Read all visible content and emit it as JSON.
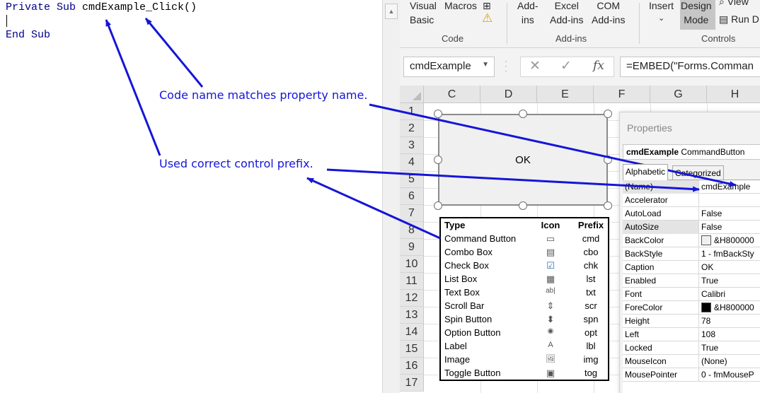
{
  "code": {
    "line1_kw": "Private Sub",
    "line1_name": " cmdExample_Click()",
    "line2": "End Sub"
  },
  "ribbon": {
    "visual_basic": "Visual\nBasic",
    "macros": "Macros",
    "addins": "Add-\nins",
    "excel_addins": "Excel\nAdd-ins",
    "com_addins": "COM\nAdd-ins",
    "insert": "Insert",
    "design_mode": "Design\nMode",
    "view_partial": "View",
    "run_partial": "Run D",
    "group_code": "Code",
    "group_addins": "Add-ins",
    "group_controls": "Controls"
  },
  "formula_bar": {
    "name_box": "cmdExample",
    "formula": "=EMBED(\"Forms.Comman"
  },
  "grid": {
    "columns": [
      "C",
      "D",
      "E",
      "F",
      "G",
      "H"
    ],
    "rows": [
      "1",
      "2",
      "3",
      "4",
      "5",
      "6",
      "7",
      "8",
      "9",
      "10",
      "11",
      "12",
      "13",
      "14",
      "15",
      "16",
      "17"
    ]
  },
  "ok_button": {
    "caption": "OK"
  },
  "prefix_table": {
    "headers": {
      "type": "Type",
      "icon": "Icon",
      "prefix": "Prefix"
    },
    "rows": [
      {
        "type": "Command Button",
        "icon": "▭",
        "prefix": "cmd"
      },
      {
        "type": "Combo Box",
        "icon": "▤",
        "prefix": "cbo"
      },
      {
        "type": "Check Box",
        "icon": "☑",
        "prefix": "chk"
      },
      {
        "type": "List Box",
        "icon": "▦",
        "prefix": "lst"
      },
      {
        "type": "Text Box",
        "icon": "ab|",
        "prefix": "txt"
      },
      {
        "type": "Scroll Bar",
        "icon": "⇕",
        "prefix": "scr"
      },
      {
        "type": "Spin Button",
        "icon": "⬍",
        "prefix": "spn"
      },
      {
        "type": "Option Button",
        "icon": "◉",
        "prefix": "opt"
      },
      {
        "type": "Label",
        "icon": "A",
        "prefix": "lbl"
      },
      {
        "type": "Image",
        "icon": "🖼",
        "prefix": "img"
      },
      {
        "type": "Toggle Button",
        "icon": "▣",
        "prefix": "tog"
      }
    ]
  },
  "properties": {
    "title": "Properties",
    "object_name": "cmdExample",
    "object_type": "CommandButton",
    "tab_alphabetic": "Alphabetic",
    "tab_categorized": "Categorized",
    "rows": [
      {
        "name": "(Name)",
        "value": "cmdExample"
      },
      {
        "name": "Accelerator",
        "value": ""
      },
      {
        "name": "AutoLoad",
        "value": "False"
      },
      {
        "name": "AutoSize",
        "value": "False"
      },
      {
        "name": "BackColor",
        "value": "&H800000"
      },
      {
        "name": "BackStyle",
        "value": "1 - fmBackSty"
      },
      {
        "name": "Caption",
        "value": "OK"
      },
      {
        "name": "Enabled",
        "value": "True"
      },
      {
        "name": "Font",
        "value": "Calibri"
      },
      {
        "name": "ForeColor",
        "value": "&H800000"
      },
      {
        "name": "Height",
        "value": "78"
      },
      {
        "name": "Left",
        "value": "108"
      },
      {
        "name": "Locked",
        "value": "True"
      },
      {
        "name": "MouseIcon",
        "value": "(None)"
      },
      {
        "name": "MousePointer",
        "value": "0 - fmMouseP"
      }
    ],
    "swatch_colors": {
      "BackColor": "#f0f0f0",
      "ForeColor": "#000000"
    }
  },
  "annotations": {
    "code_name": "Code name matches property name.",
    "prefix": "Used correct control prefix."
  },
  "colors": {
    "annotation": "#1515d8",
    "code_keyword": "#00008b"
  }
}
